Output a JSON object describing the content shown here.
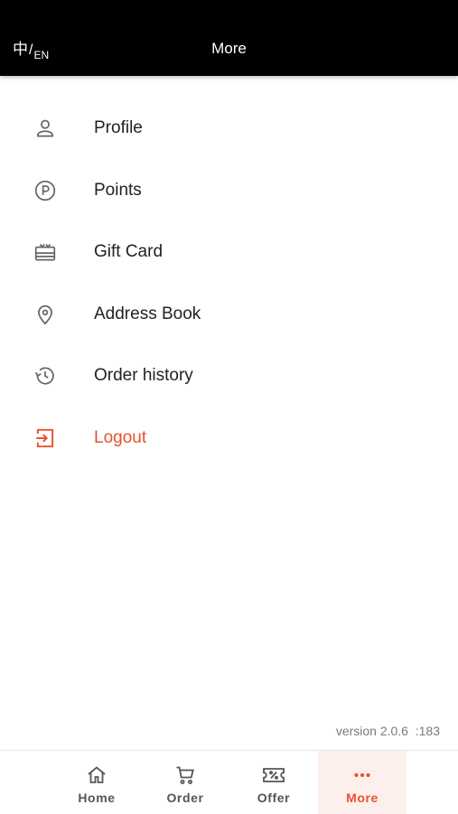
{
  "header": {
    "lang_zh": "中",
    "lang_slash": "/",
    "lang_en": "EN",
    "title": "More"
  },
  "menu": {
    "items": [
      {
        "label": "Profile",
        "icon": "person-icon"
      },
      {
        "label": "Points",
        "icon": "points-p-icon"
      },
      {
        "label": "Gift Card",
        "icon": "gift-card-icon"
      },
      {
        "label": "Address Book",
        "icon": "location-pin-icon"
      },
      {
        "label": "Order history",
        "icon": "history-icon"
      },
      {
        "label": "Logout",
        "icon": "logout-icon"
      }
    ]
  },
  "version_text": "version 2.0.6  :183",
  "tabs": [
    {
      "label": "Home",
      "icon": "home-icon",
      "active": false
    },
    {
      "label": "Order",
      "icon": "cart-icon",
      "active": false
    },
    {
      "label": "Offer",
      "icon": "coupon-icon",
      "active": false
    },
    {
      "label": "More",
      "icon": "more-dots-icon",
      "active": true
    }
  ],
  "colors": {
    "accent": "#e5532d",
    "header_bg": "#000000",
    "text": "#222222",
    "icon_gray": "#666666",
    "active_tab_bg": "#fdf0ec"
  }
}
